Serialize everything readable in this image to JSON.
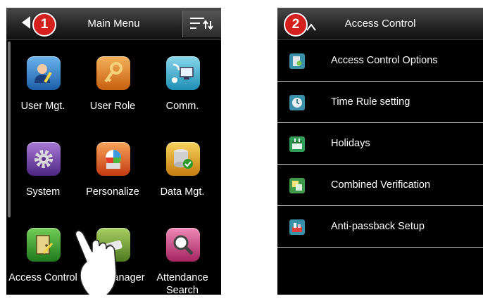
{
  "left_panel": {
    "badge": "1",
    "title": "Main Menu",
    "items": [
      {
        "label": "User Mgt.",
        "icon": "user-mgt-icon",
        "color": "#2e7fc8"
      },
      {
        "label": "User Role",
        "icon": "key-icon",
        "color": "#e07a1f"
      },
      {
        "label": "Comm.",
        "icon": "network-icon",
        "color": "#3fa8c9"
      },
      {
        "label": "System",
        "icon": "gear-icon",
        "color": "#7a4aa8"
      },
      {
        "label": "Personalize",
        "icon": "palette-icon",
        "color": "#e2582a"
      },
      {
        "label": "Data Mgt.",
        "icon": "database-icon",
        "color": "#e5a21d"
      },
      {
        "label": "Access Control",
        "icon": "door-icon",
        "color": "#3a9a2e"
      },
      {
        "label": "USB Manager",
        "icon": "usb-icon",
        "color": "#6d8e2a"
      },
      {
        "label": "Attendance Search",
        "icon": "search-icon",
        "color": "#c73a7e"
      }
    ]
  },
  "right_panel": {
    "badge": "2",
    "title": "Access Control",
    "items": [
      {
        "label": "Access Control Options",
        "icon": "options-icon"
      },
      {
        "label": "Time Rule setting",
        "icon": "clock-icon"
      },
      {
        "label": "Holidays",
        "icon": "calendar-icon"
      },
      {
        "label": "Combined Verification",
        "icon": "combined-icon"
      },
      {
        "label": "Anti-passback Setup",
        "icon": "anti-passback-icon"
      }
    ]
  }
}
